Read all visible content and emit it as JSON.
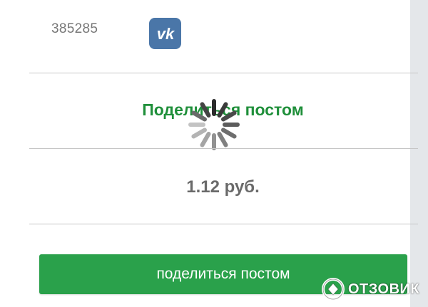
{
  "share_row": {
    "count": "385285",
    "network_icon": "vk-logo-icon",
    "network_color": "#4a76a8"
  },
  "share_action": {
    "heading": "Поделиться постом",
    "heading_color": "#1f8f3a",
    "loading_indicator": "spinner-icon"
  },
  "reward": {
    "price": "1.12 руб."
  },
  "button": {
    "label": "поделиться постом",
    "color": "#2aa14b"
  },
  "watermark": {
    "text": "ОТЗОВИК",
    "icon": "otzovik-logo-icon"
  }
}
